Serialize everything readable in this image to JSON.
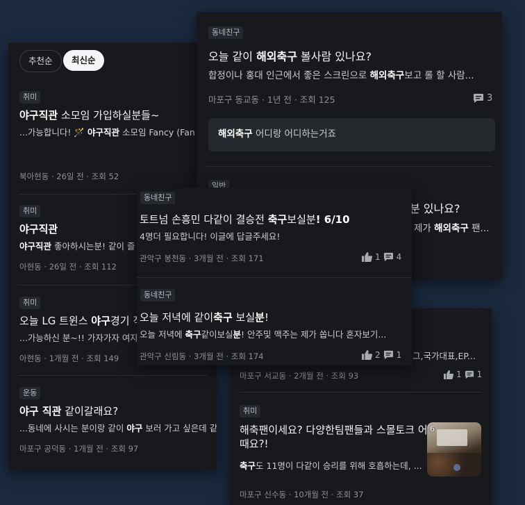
{
  "sort": {
    "recommended": "추천순",
    "latest": "최신순"
  },
  "card_left": {
    "posts": [
      {
        "tag": "취미",
        "title_parts": [
          "야구직관",
          " 소모임 가입하실분들~"
        ],
        "snippet_parts": [
          "...가능합니다! 🪄 ",
          "야구직관",
          " 소모임 Fancy (Fan ."
        ],
        "meta": "북아현동 · 26일 전 · 조회 52"
      },
      {
        "tag": "취미",
        "title_parts": [
          "야구직관",
          ""
        ],
        "snippet_parts": [
          "야구직관",
          " 좋아하시는분! 같이 즐"
        ],
        "meta": "아현동 · 26일 전 · 조회 112"
      },
      {
        "tag": "취미",
        "title_parts": [
          "오늘 LG 트윈스 ",
          "야구",
          "경기 직"
        ],
        "snippet": "...가능하신 분~!! 가자가자 여자",
        "meta": "아현동 · 1개월 전 · 조회 149"
      },
      {
        "tag": "운동",
        "title_parts": [
          "야구 직관",
          " 같이갈래요?"
        ],
        "snippet_parts": [
          "...동네에 사시는 분이랑 같이 ",
          "야구",
          " 보러 가고 싶은데 같이 가"
        ],
        "meta": "마포구 공덕동 · 1개월 전 · 조회 97"
      }
    ]
  },
  "card_top": {
    "tag": "동네친구",
    "title_parts": [
      "오늘 같이 ",
      "해외축구",
      " 볼사람 있나요?"
    ],
    "snippet_parts": [
      "합정이나 홍대 인근에서 좋은 스크린으로 ",
      "해외축구",
      "보고 롤 할 사람..."
    ],
    "meta": "마포구 동교동 · 1년 전 · 조회 125",
    "comments": "3",
    "reply_parts": [
      "해외축구",
      " 어디랑 어디하는거죠"
    ],
    "tag2": "일반",
    "title2_tail": "분 있나요?",
    "snippet2_parts": [
      "제가 ",
      "해외축구",
      " 팬..."
    ]
  },
  "card_mid": {
    "posts": [
      {
        "tag": "동네친구",
        "title_parts": [
          "토트넘 손흥민 다같이 결승전 ",
          "축구",
          "보실분",
          "! 6/10"
        ],
        "snippet": "4명더 필요합니다! 이글에 답글주세요!",
        "meta": "관악구 봉천동 · 3개월 전 · 조회 171",
        "likes": "1",
        "comments": "4"
      },
      {
        "tag": "동네친구",
        "title_parts": [
          "오늘 저녁에 같이",
          "축구",
          " 보실",
          "분",
          "!"
        ],
        "snippet_parts": [
          "오늘 저녁에 ",
          "축구",
          "같이보실",
          "분",
          "! 안주및 맥주는 제가 쏩니다 혼자보기..."
        ],
        "meta": "관악구 신림동 · 3개월 전 · 조회 174",
        "likes": "2",
        "comments": "1"
      }
    ]
  },
  "card_bottom": {
    "snippet_tail": "그,국가대표,EP...",
    "meta1": "마포구 서교동 · 2개월 전 · 조회 93",
    "likes1": "1",
    "comments1": "1",
    "tag": "취미",
    "title_line1": "해축팬이세요? 다양한팀팬들과 스몰토크 어",
    "title_line2": "때요?!",
    "snippet_parts": [
      "축구",
      "도 11명이 다같이 승리를 위해 호흡하는데, ..."
    ],
    "meta2": "마포구 신수동 · 10개월 전 · 조회 37",
    "thumb_count": "6"
  },
  "icons": {
    "like": "thumbs-up-icon",
    "comment": "comment-icon"
  },
  "colors": {
    "background": "#1b2a3e",
    "card": "#17191d",
    "highlight": "#ffffff"
  }
}
